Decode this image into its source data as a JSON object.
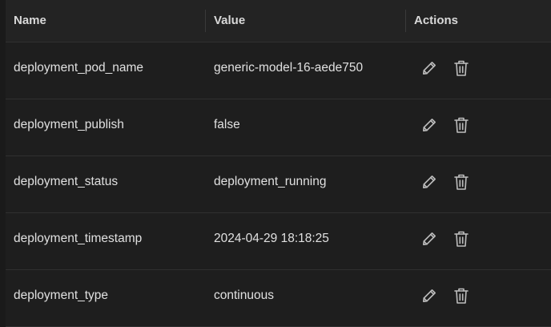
{
  "columns": {
    "name": "Name",
    "value": "Value",
    "actions": "Actions"
  },
  "rows": [
    {
      "name": "deployment_pod_name",
      "value": "generic-model-16-aede750"
    },
    {
      "name": "deployment_publish",
      "value": "false"
    },
    {
      "name": "deployment_status",
      "value": "deployment_running"
    },
    {
      "name": "deployment_timestamp",
      "value": "2024-04-29 18:18:25"
    },
    {
      "name": "deployment_type",
      "value": "continuous"
    }
  ],
  "icons": {
    "edit": "pencil-icon",
    "delete": "trash-icon"
  },
  "colors": {
    "background": "#1e1e1e",
    "header": "#232323",
    "border": "#303030",
    "icon": "#bdbdbd",
    "text": "#e0e0e0"
  }
}
